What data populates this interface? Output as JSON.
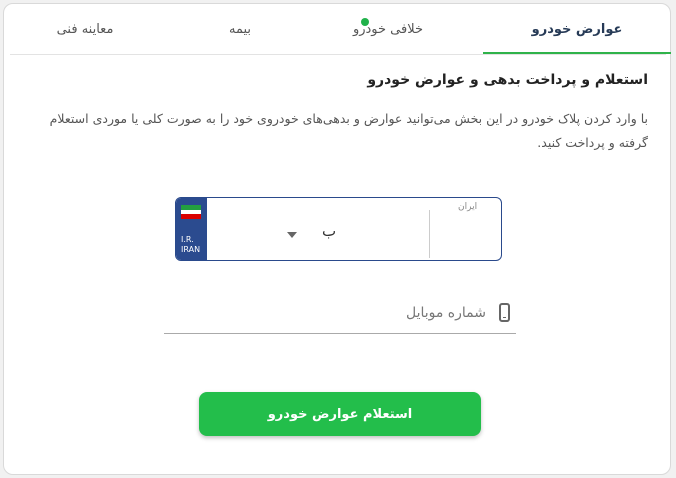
{
  "tabs": [
    {
      "label": "عوارض خودرو",
      "active": true
    },
    {
      "label": "خلافی خودرو",
      "active": false,
      "badge_color": "#21b24b"
    },
    {
      "label": "بیمه",
      "active": false
    },
    {
      "label": "معاینه فنی",
      "active": false
    }
  ],
  "main": {
    "title": "استعلام و پرداخت بدهی و عوارض خودرو",
    "description": "با وارد کردن پلاک خودرو در این بخش می‌توانید عوارض و بدهی‌های خودروی خود را به صورت کلی یا موردی استعلام گرفته و پرداخت کنید."
  },
  "plate": {
    "band_line1": "I.R.",
    "band_line2": "IRAN",
    "iran_label": "ایران",
    "letter_value": "ب"
  },
  "mobile": {
    "placeholder": "شماره موبایل",
    "icon": "mobile-phone-icon"
  },
  "submit": {
    "label": "استعلام عوارض خودرو"
  },
  "colors": {
    "accent": "#23be4b",
    "plate_blue": "#2b4b8f",
    "title_navy": "#263a56"
  }
}
